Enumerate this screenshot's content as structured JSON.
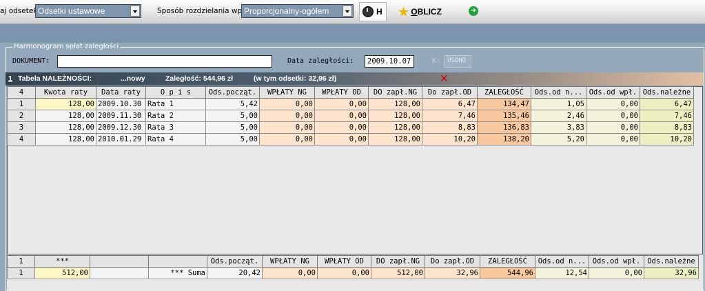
{
  "toolbar": {
    "interest_label": "aj odsetek:",
    "interest_value": "Odsetki ustawowe",
    "split_label": "Sposób rozdzielania wpłat:",
    "split_value": "Proporcjonalny-ogółem",
    "h_label": "H",
    "calc_label": "OBLICZ",
    "calc_underline": "O",
    "calc_rest": "BLICZ"
  },
  "panel": {
    "title": "Harmonogram spłat zaległości",
    "document_label": "DOKUMENT:",
    "document_value": "",
    "date_label": "Data zaległości:",
    "date_value": "2009.10.07",
    "k_label": "K:",
    "k_value": "USOHO"
  },
  "strip": {
    "index": "1",
    "title": "Tabela NALEŻNOŚCI:",
    "new": "...nowy",
    "debt": "Zaległość: 544,96 zł",
    "interest": "(w tym odsetki: 32,96 zł)"
  },
  "main_table": {
    "count": "4",
    "headers": [
      "Kwota raty",
      "Data raty",
      "O p i s",
      "Ods.począt.",
      "WPŁATY NG",
      "WPŁATY OD",
      "DO zapł.NG",
      "Do zapł.OD",
      "ZALEGŁOŚĆ",
      "Ods.od n...",
      "Ods.od wpł.",
      "Ods.należne"
    ],
    "rows": [
      [
        "1",
        "128,00",
        "2009.10.30",
        "Rata 1",
        "5,42",
        "0,00",
        "0,00",
        "128,00",
        "6,47",
        "134,47",
        "1,05",
        "0,00",
        "6,47"
      ],
      [
        "2",
        "128,00",
        "2009.11.30",
        "Rata 2",
        "5,00",
        "0,00",
        "0,00",
        "128,00",
        "7,46",
        "135,46",
        "2,46",
        "0,00",
        "7,46"
      ],
      [
        "3",
        "128,00",
        "2009.12.30",
        "Rata 3",
        "5,00",
        "0,00",
        "0,00",
        "128,00",
        "8,83",
        "136,83",
        "3,83",
        "0,00",
        "8,83"
      ],
      [
        "4",
        "128,00",
        "2010.01.29",
        "Rata 4",
        "5,00",
        "0,00",
        "0,00",
        "128,00",
        "10,20",
        "138,20",
        "5,20",
        "0,00",
        "10,20"
      ]
    ]
  },
  "sum_table": {
    "count": "1",
    "headers": [
      "***",
      "",
      "",
      "Ods.począt.",
      "WPŁATY NG",
      "WPŁATY OD",
      "DO zapł.NG",
      "Do zapł.OD",
      "ZALEGŁOŚĆ",
      "Ods.od n...",
      "Ods.od wpł.",
      "Ods.należne"
    ],
    "row": [
      "1",
      "512,00",
      "",
      "*** Suma",
      "20,42",
      "0,00",
      "0,00",
      "512,00",
      "32,96",
      "544,96",
      "12,54",
      "0,00",
      "32,96"
    ]
  }
}
